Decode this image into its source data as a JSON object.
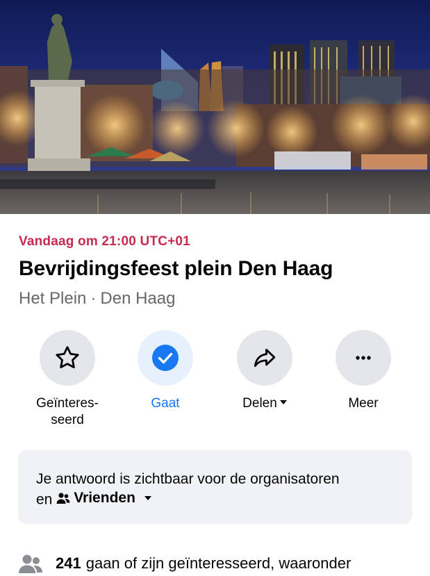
{
  "cover": {
    "alt_description_icon": "event-cover-photo",
    "sky_top": "#14205e",
    "sky_bottom": "#2a3c8c"
  },
  "event": {
    "datetime": "Vandaag om 21:00 UTC+01",
    "title": "Bevrijdingsfeest plein Den Haag",
    "venue": "Het Plein",
    "separator": "·",
    "city": "Den Haag"
  },
  "actions": [
    {
      "id": "interested",
      "label_line1": "Geïnteres-",
      "label_line2": "seerd",
      "icon": "star-icon",
      "active": false
    },
    {
      "id": "going",
      "label": "Gaat",
      "icon": "checkmark-icon",
      "active": true
    },
    {
      "id": "share",
      "label": "Delen",
      "icon": "share-arrow-icon",
      "has_dropdown": true
    },
    {
      "id": "more",
      "label": "Meer",
      "icon": "more-dots-icon"
    }
  ],
  "notice": {
    "text_line1": "Je antwoord is zichtbaar voor de organisatoren",
    "text_prefix": "en",
    "audience": "Vrienden",
    "audience_icon": "friends-icon"
  },
  "attendance": {
    "count": "241",
    "text": "gaan of zijn geïnteresseerd, waaronder",
    "icon": "people-icon"
  },
  "colors": {
    "accent_red": "#c62a50",
    "brand_blue": "#1877f2",
    "secondary_text": "#65676b",
    "button_bg": "#e4e6eb",
    "notice_bg": "#f0f2f5"
  }
}
